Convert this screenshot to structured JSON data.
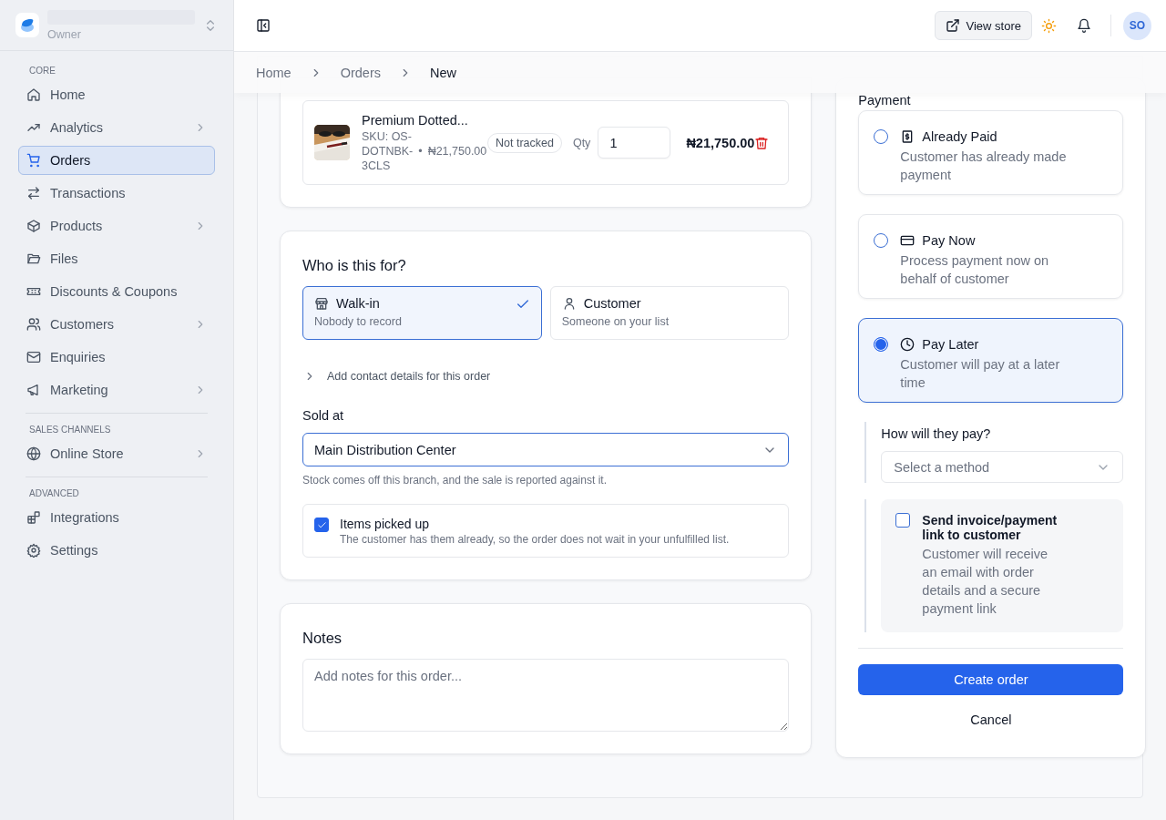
{
  "sidebar": {
    "account_role": "Owner",
    "sections": [
      {
        "label": "CORE",
        "items": [
          {
            "label": "Home",
            "expandable": false,
            "selected": false
          },
          {
            "label": "Analytics",
            "expandable": true,
            "selected": false
          },
          {
            "label": "Orders",
            "expandable": false,
            "selected": true
          },
          {
            "label": "Transactions",
            "expandable": false,
            "selected": false
          },
          {
            "label": "Products",
            "expandable": true,
            "selected": false
          },
          {
            "label": "Files",
            "expandable": false,
            "selected": false
          },
          {
            "label": "Discounts & Coupons",
            "expandable": false,
            "selected": false
          },
          {
            "label": "Customers",
            "expandable": true,
            "selected": false
          },
          {
            "label": "Enquiries",
            "expandable": false,
            "selected": false
          },
          {
            "label": "Marketing",
            "expandable": true,
            "selected": false
          }
        ]
      },
      {
        "label": "SALES CHANNELS",
        "items": [
          {
            "label": "Online Store",
            "expandable": true,
            "selected": false
          }
        ]
      },
      {
        "label": "ADVANCED",
        "items": [
          {
            "label": "Integrations",
            "expandable": false,
            "selected": false
          },
          {
            "label": "Settings",
            "expandable": false,
            "selected": false
          }
        ]
      }
    ]
  },
  "topbar": {
    "view_store": "View store",
    "avatar": "SO"
  },
  "breadcrumb": [
    {
      "label": "Home",
      "current": false
    },
    {
      "label": "Orders",
      "current": false
    },
    {
      "label": "New",
      "current": true
    }
  ],
  "order_items": [
    {
      "name": "Premium Dotted...",
      "sku": "SKU: OS-DOTNBK-3CLS",
      "separator": "•",
      "unit_price": "₦21,750.00",
      "stock_badge": "Not tracked",
      "qty_label": "Qty",
      "qty": "1",
      "total": "₦21,750.00"
    }
  ],
  "customer": {
    "heading": "Who is this for?",
    "options": [
      {
        "kind": "walk_in",
        "title": "Walk-in",
        "subtitle": "Nobody to record",
        "selected": true
      },
      {
        "kind": "customer",
        "title": "Customer",
        "subtitle": "Someone on your list",
        "selected": false
      }
    ],
    "contact_toggle": {
      "label": "Add contact details for this order",
      "expanded": false
    },
    "sold_at": {
      "label": "Sold at",
      "value": "Main Distribution Center",
      "hint": "Stock comes off this branch, and the sale is reported against it."
    },
    "picked_up": {
      "title": "Items picked up",
      "description": "The customer has them already, so the order does not wait in your unfulfilled list.",
      "checked": true
    }
  },
  "notes": {
    "heading": "Notes",
    "placeholder": "Add notes for this order..."
  },
  "payment": {
    "heading": "Payment",
    "options": [
      {
        "kind": "paid",
        "title": "Already Paid",
        "description": "Customer has already made payment",
        "selected": false
      },
      {
        "kind": "now",
        "title": "Pay Now",
        "description": "Process payment now on behalf of customer",
        "selected": false
      },
      {
        "kind": "later",
        "title": "Pay Later",
        "description": "Customer will pay at a later time",
        "selected": true
      }
    ],
    "method": {
      "label": "How will they pay?",
      "placeholder": "Select a method"
    },
    "send_invoice": {
      "title": "Send invoice/payment link to customer",
      "description": "Customer will receive an email with order details and a secure payment link",
      "checked": false
    },
    "create_button": "Create order",
    "cancel_button": "Cancel"
  }
}
